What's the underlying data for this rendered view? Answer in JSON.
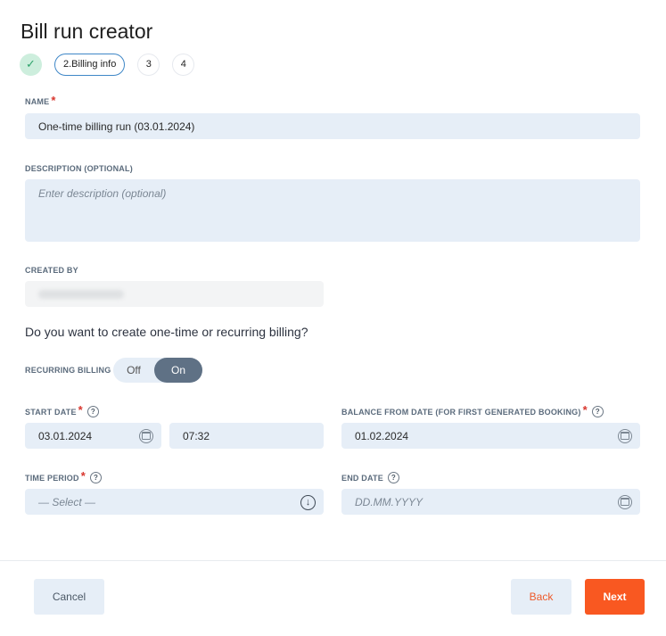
{
  "page": {
    "title": "Bill run creator"
  },
  "stepper": {
    "done_icon": "✓",
    "active_label": "2.Billing info",
    "step3": "3",
    "step4": "4"
  },
  "form": {
    "name": {
      "label": "NAME",
      "value": "One-time billing run (03.01.2024)",
      "required": true
    },
    "description": {
      "label": "DESCRIPTION (OPTIONAL)",
      "placeholder": "Enter description (optional)"
    },
    "created_by": {
      "label": "CREATED BY"
    },
    "question": "Do you want to create one-time or recurring billing?",
    "recurring": {
      "label": "RECURRING BILLING",
      "off_label": "Off",
      "on_label": "On",
      "selected": "On"
    },
    "start_date": {
      "label": "START DATE",
      "date": "03.01.2024",
      "time": "07:32",
      "required": true
    },
    "balance_from": {
      "label": "BALANCE FROM DATE (FOR FIRST GENERATED BOOKING)",
      "date": "01.02.2024",
      "required": true
    },
    "time_period": {
      "label": "TIME PERIOD",
      "placeholder": "— Select —",
      "required": true
    },
    "end_date": {
      "label": "END DATE",
      "placeholder": "DD.MM.YYYY"
    },
    "required_mark": "*",
    "help_mark": "?"
  },
  "footer": {
    "cancel": "Cancel",
    "back": "Back",
    "next": "Next"
  },
  "colors": {
    "accent": "#f95821",
    "field_bg": "#e6eef7",
    "toggle_on": "#5f7185",
    "required": "#d8362e"
  },
  "icons": {
    "calendar": "calendar-icon",
    "dropdown": "arrow-down-circle-icon",
    "help": "help-icon",
    "check": "check-icon"
  }
}
